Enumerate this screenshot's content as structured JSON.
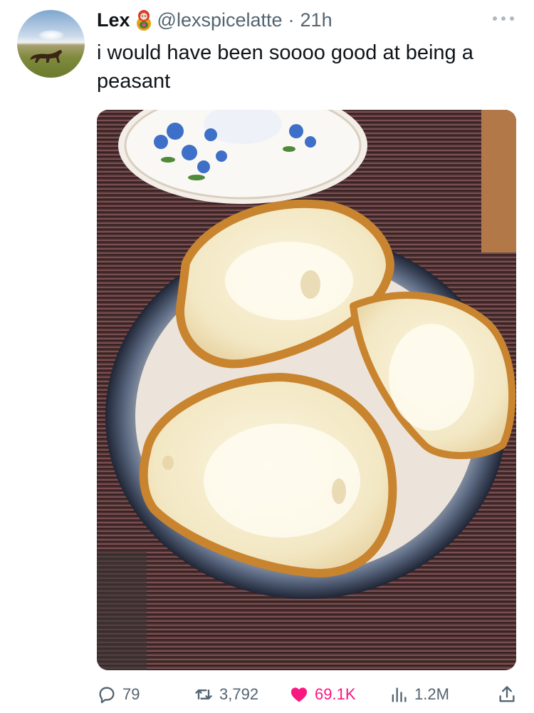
{
  "tweet": {
    "author_name": "Lex",
    "handle": "@lexspicelatte",
    "separator": "·",
    "time_ago": "21h",
    "text": "i would have been soooo good at being a peasant"
  },
  "icons": {
    "verified_like": "matryoshka-doll-emoji",
    "more": "more-dots-icon",
    "reply": "reply-icon",
    "retweet": "retweet-icon",
    "like": "heart-icon",
    "views": "views-chart-icon",
    "share": "share-icon"
  },
  "actions": {
    "reply_count": "79",
    "retweet_count": "3,792",
    "like_count": "69.1K",
    "view_count": "1.2M"
  },
  "colors": {
    "like_active": "#f91880",
    "secondary_text": "#536471",
    "primary_text": "#0f1419"
  }
}
